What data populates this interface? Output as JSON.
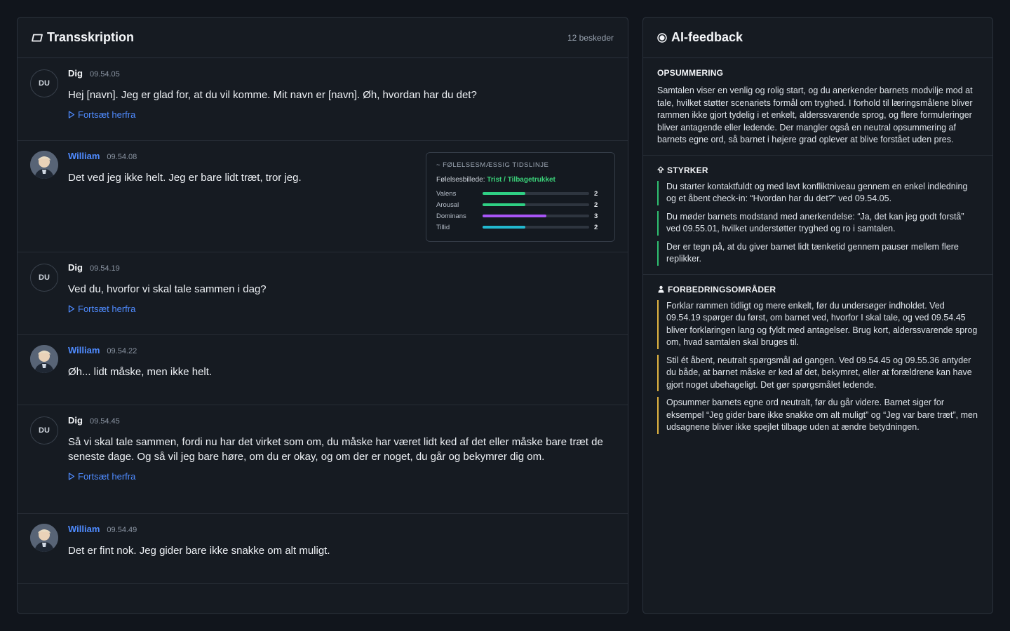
{
  "transcript": {
    "title": "Transskription",
    "count": "12 beskeder",
    "continue_label": "Fortsæt herfra",
    "messages": [
      {
        "avatar": "DU",
        "sender": "Dig",
        "time": "09.54.05",
        "text": "Hej [navn]. Jeg er glad for, at du vil komme. Mit navn er [navn]. Øh, hvordan har du det?"
      },
      {
        "sender": "William",
        "time": "09.54.08",
        "text": "Det ved jeg ikke helt. Jeg er bare lidt træt, tror jeg."
      },
      {
        "avatar": "DU",
        "sender": "Dig",
        "time": "09.54.19",
        "text": "Ved du, hvorfor vi skal tale sammen i dag?"
      },
      {
        "sender": "William",
        "time": "09.54.22",
        "text": "Øh... lidt måske, men ikke helt."
      },
      {
        "avatar": "DU",
        "sender": "Dig",
        "time": "09.54.45",
        "text": "Så vi skal tale sammen, fordi nu har det virket som om, du måske har været lidt ked af det eller måske bare træt de seneste dage. Og så vil jeg bare høre, om du er okay, og om der er noget, du går og bekymrer dig om."
      },
      {
        "sender": "William",
        "time": "09.54.49",
        "text": "Det er fint nok. Jeg gider bare ikke snakke om alt muligt."
      }
    ],
    "emotion": {
      "title": "~ FØLELSESMÆSSIG TIDSLINJE",
      "picture_label": "Følelsesbillede:",
      "picture_value": "Trist / Tilbagetrukket",
      "scale_max": 5,
      "rows": [
        {
          "label": "Valens",
          "value": 2,
          "color": "#2fcf84"
        },
        {
          "label": "Arousal",
          "value": 2,
          "color": "#2fcf84"
        },
        {
          "label": "Dominans",
          "value": 3,
          "color": "#a855f7"
        },
        {
          "label": "Tillid",
          "value": 2,
          "color": "#22b8cf"
        }
      ]
    }
  },
  "feedback": {
    "title": "AI-feedback",
    "summary": {
      "heading": "OPSUMMERING",
      "text": "Samtalen viser en venlig og rolig start, og du anerkender barnets modvilje mod at tale, hvilket støtter scenariets formål om tryghed. I forhold til læringsmålene bliver rammen ikke gjort tydelig i et enkelt, alderssvarende sprog, og flere formuleringer bliver antagende eller ledende. Der mangler også en neutral opsummering af barnets egne ord, så barnet i højere grad oplever at blive forstået uden pres."
    },
    "strengths": {
      "heading": "STYRKER",
      "items": [
        "Du starter kontaktfuldt og med lavt konfliktniveau gennem en enkel indledning og et åbent check-in: “Hvordan har du det?” ved 09.54.05.",
        "Du møder barnets modstand med anerkendelse: “Ja, det kan jeg godt forstå” ved 09.55.01, hvilket understøtter tryghed og ro i samtalen.",
        "Der er tegn på, at du giver barnet lidt tænketid gennem pauser mellem flere replikker."
      ]
    },
    "improvements": {
      "heading": "FORBEDRINGSOMRÅDER",
      "items": [
        "Forklar rammen tidligt og mere enkelt, før du undersøger indholdet. Ved 09.54.19 spørger du først, om barnet ved, hvorfor I skal tale, og ved 09.54.45 bliver forklaringen lang og fyldt med antagelser. Brug kort, alderssvarende sprog om, hvad samtalen skal bruges til.",
        "Stil ét åbent, neutralt spørgsmål ad gangen. Ved 09.54.45 og 09.55.36 antyder du både, at barnet måske er ked af det, bekymret, eller at forældrene kan have gjort noget ubehageligt. Det gør spørgsmålet ledende.",
        "Opsummer barnets egne ord neutralt, før du går videre. Barnet siger for eksempel “Jeg gider bare ikke snakke om alt muligt” og “Jeg var bare træt”, men udsagnene bliver ikke spejlet tilbage uden at ændre betydningen."
      ]
    }
  }
}
